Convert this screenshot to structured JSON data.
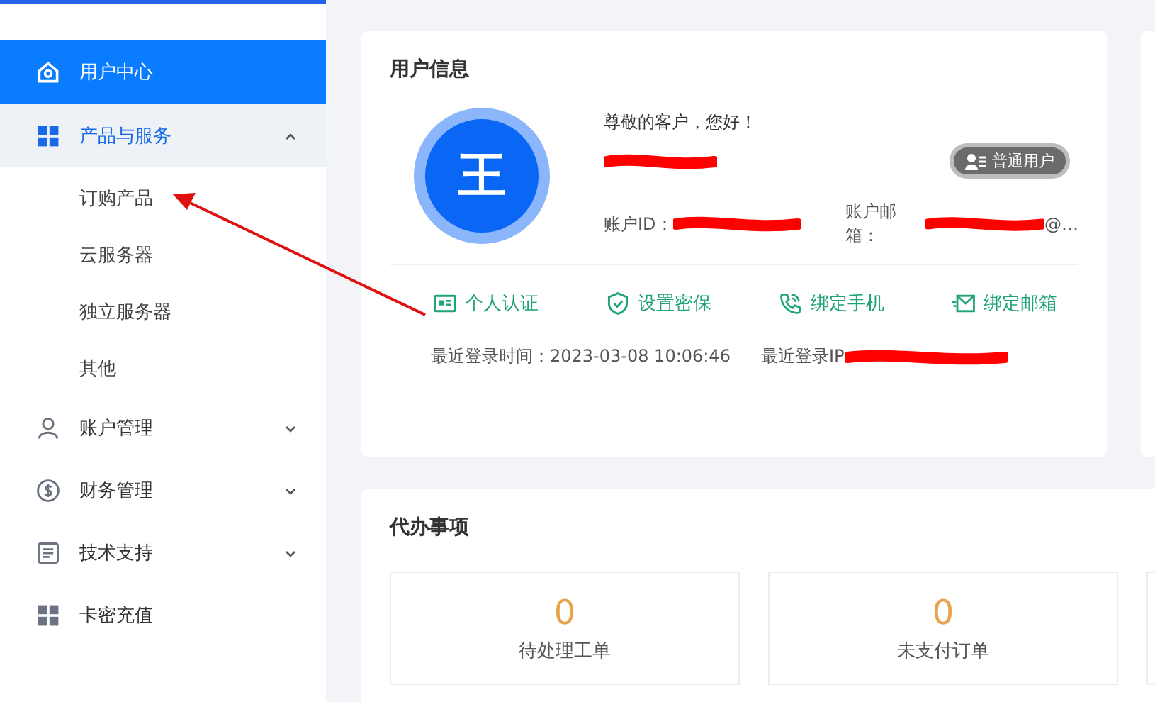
{
  "sidebar": {
    "items": [
      {
        "label": "用户中心",
        "kind": "link",
        "selected": true
      },
      {
        "label": "产品与服务",
        "kind": "group",
        "selected": false,
        "expanded": true,
        "children": [
          {
            "label": "订购产品",
            "selected": false
          },
          {
            "label": "云服务器",
            "selected": false
          },
          {
            "label": "独立服务器",
            "selected": false
          },
          {
            "label": "其他",
            "selected": false
          }
        ]
      },
      {
        "label": "账户管理",
        "kind": "group",
        "selected": false,
        "expanded": false
      },
      {
        "label": "财务管理",
        "kind": "group",
        "selected": false,
        "expanded": false
      },
      {
        "label": "技术支持",
        "kind": "group",
        "selected": false,
        "expanded": false
      },
      {
        "label": "卡密充值",
        "kind": "link",
        "selected": false
      }
    ]
  },
  "user_info": {
    "title": "用户信息",
    "avatar": "王",
    "greeting": "尊敬的客户，您好！",
    "badge": "普通用户",
    "account_id_label": "账户ID：",
    "email_label": "账户邮箱：",
    "email_value": "@…",
    "actions": [
      "个人认证",
      "设置密保",
      "绑定手机",
      "绑定邮箱"
    ],
    "last_login_time": "最近登录时间：2023-03-08 10:06:46",
    "last_login_ip_label": "最近登录IP"
  },
  "todo": {
    "title": "代办事项",
    "tiles": [
      {
        "value": "0",
        "label": "待处理工单"
      },
      {
        "value": "0",
        "label": "未支付订单"
      }
    ]
  }
}
